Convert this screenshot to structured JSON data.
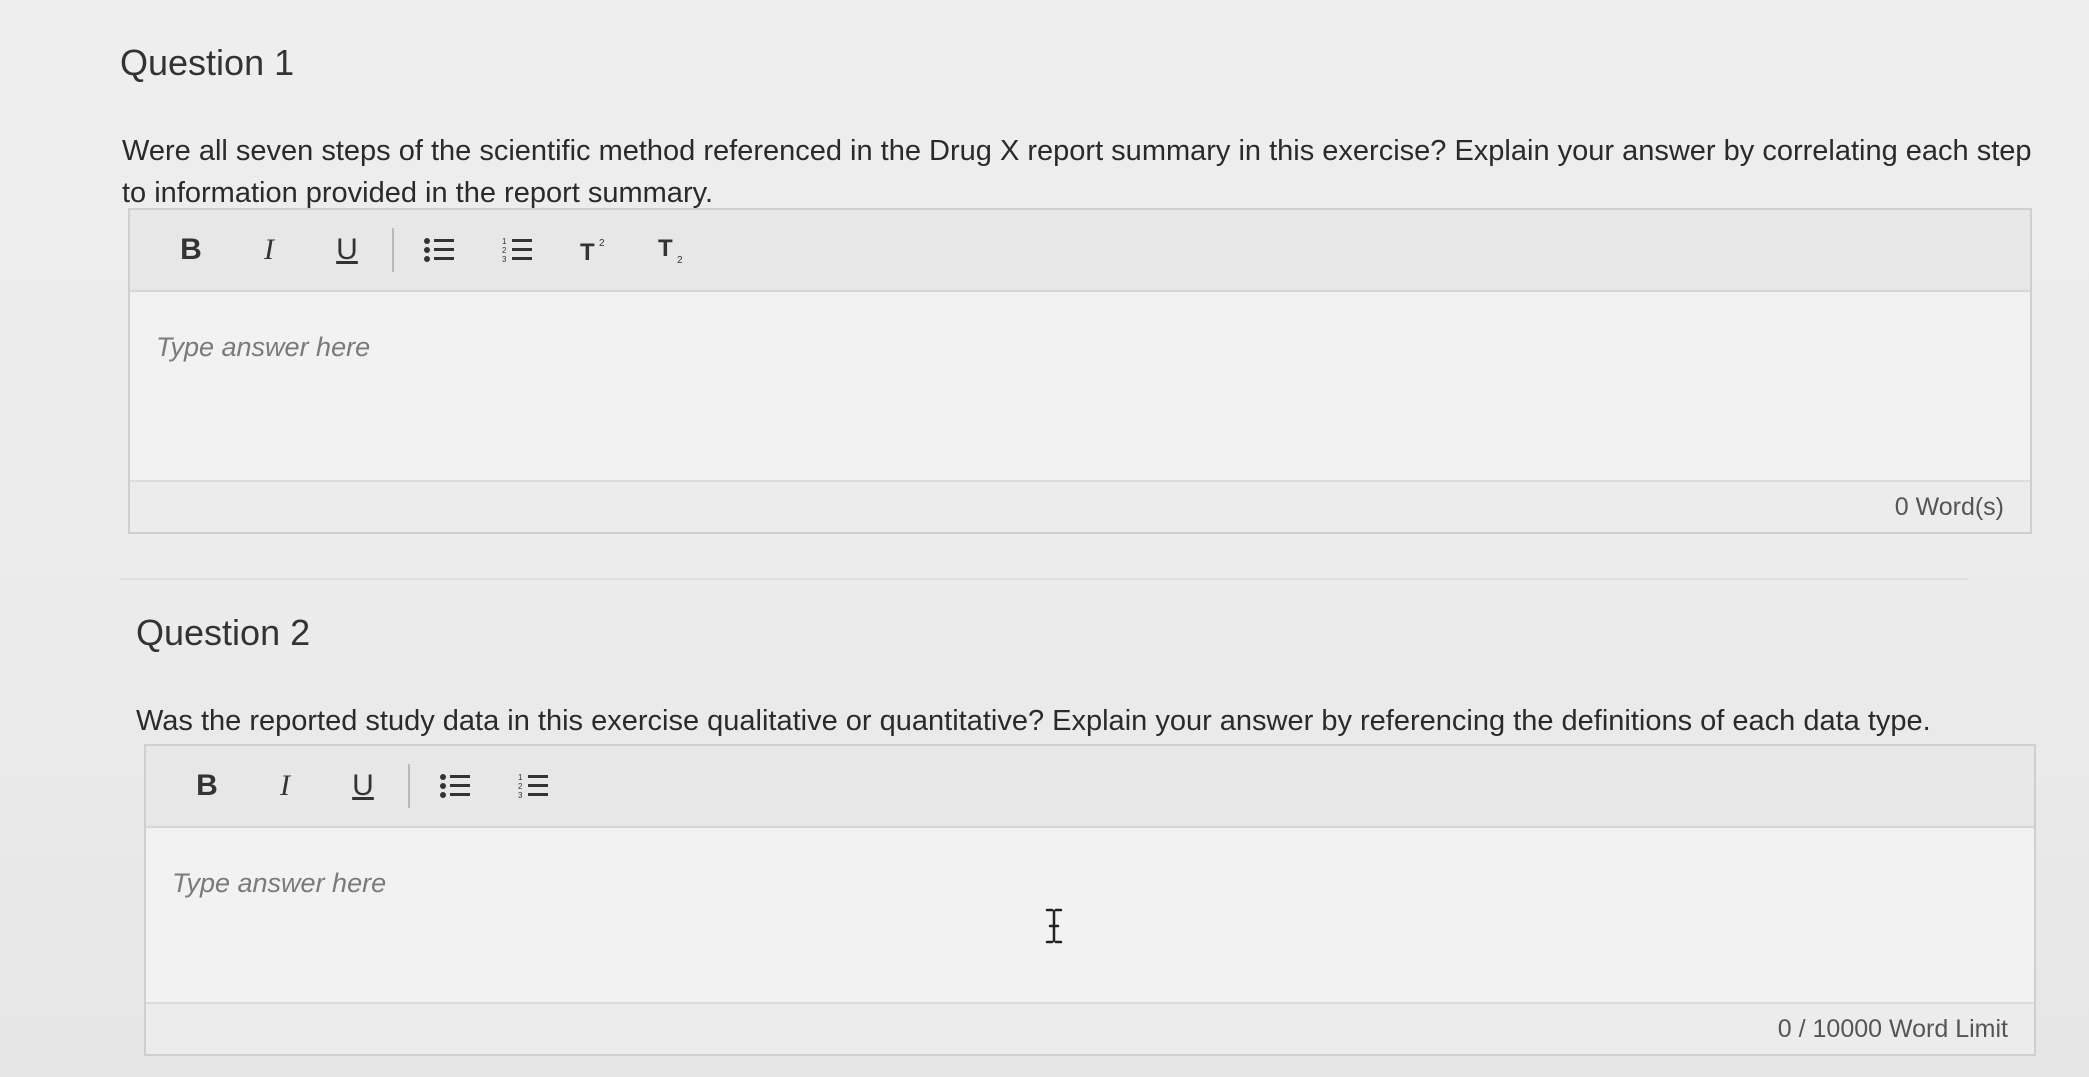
{
  "questions": [
    {
      "title": "Question 1",
      "prompt": "Were all seven steps of the scientific method referenced in the Drug X report summary in this exercise? Explain your answer by correlating each step to information provided in the report summary.",
      "editor": {
        "toolbar": [
          "B",
          "I",
          "U",
          "bulleted-list",
          "numbered-list",
          "superscript",
          "subscript"
        ],
        "placeholder": "Type answer here",
        "footer": "0 Word(s)"
      }
    },
    {
      "title": "Question 2",
      "prompt": "Was the reported study data in this exercise qualitative or quantitative? Explain your answer by referencing the definitions of each data type.",
      "editor": {
        "toolbar": [
          "B",
          "I",
          "U",
          "bulleted-list",
          "numbered-list"
        ],
        "placeholder": "Type answer here",
        "footer": "0 / 10000 Word Limit"
      }
    }
  ],
  "labels": {
    "bold": "B",
    "italic": "I",
    "underline": "U"
  }
}
